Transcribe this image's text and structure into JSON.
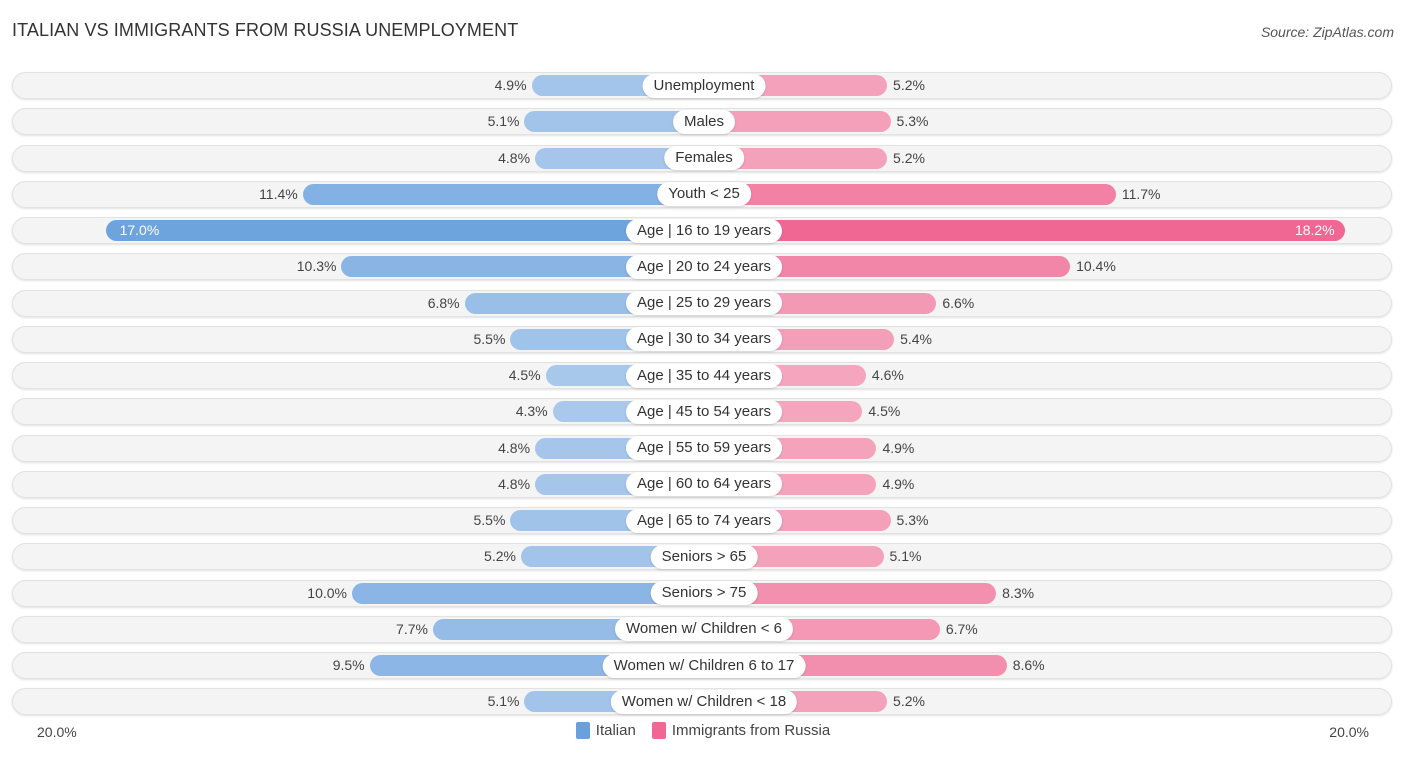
{
  "header": {
    "title": "ITALIAN VS IMMIGRANTS FROM RUSSIA UNEMPLOYMENT",
    "source": "Source: ZipAtlas.com"
  },
  "colors": {
    "italian": "#6aa1dd",
    "russia": "#f06793",
    "italian_light": "#a9c8ec",
    "russia_light": "#f5a8c0"
  },
  "chart_data": {
    "type": "bar",
    "orientation": "horizontal-diverging",
    "title": "ITALIAN VS IMMIGRANTS FROM RUSSIA UNEMPLOYMENT",
    "categories": [
      "Unemployment",
      "Males",
      "Females",
      "Youth < 25",
      "Age | 16 to 19 years",
      "Age | 20 to 24 years",
      "Age | 25 to 29 years",
      "Age | 30 to 34 years",
      "Age | 35 to 44 years",
      "Age | 45 to 54 years",
      "Age | 55 to 59 years",
      "Age | 60 to 64 years",
      "Age | 65 to 74 years",
      "Seniors > 65",
      "Seniors > 75",
      "Women w/ Children < 6",
      "Women w/ Children 6 to 17",
      "Women w/ Children < 18"
    ],
    "series": [
      {
        "name": "Italian",
        "side": "left",
        "values": [
          4.9,
          5.1,
          4.8,
          11.4,
          17.0,
          10.3,
          6.8,
          5.5,
          4.5,
          4.3,
          4.8,
          4.8,
          5.5,
          5.2,
          10.0,
          7.7,
          9.5,
          5.1
        ],
        "labels": [
          "4.9%",
          "5.1%",
          "4.8%",
          "11.4%",
          "17.0%",
          "10.3%",
          "6.8%",
          "5.5%",
          "4.5%",
          "4.3%",
          "4.8%",
          "4.8%",
          "5.5%",
          "5.2%",
          "10.0%",
          "7.7%",
          "9.5%",
          "5.1%"
        ]
      },
      {
        "name": "Immigrants from Russia",
        "side": "right",
        "values": [
          5.2,
          5.3,
          5.2,
          11.7,
          18.2,
          10.4,
          6.6,
          5.4,
          4.6,
          4.5,
          4.9,
          4.9,
          5.3,
          5.1,
          8.3,
          6.7,
          8.6,
          5.2
        ],
        "labels": [
          "5.2%",
          "5.3%",
          "5.2%",
          "11.7%",
          "18.2%",
          "10.4%",
          "6.6%",
          "5.4%",
          "4.6%",
          "4.5%",
          "4.9%",
          "4.9%",
          "5.3%",
          "5.1%",
          "8.3%",
          "6.7%",
          "8.6%",
          "5.2%"
        ]
      }
    ],
    "xlim": [
      -20,
      20
    ],
    "axis_labels": {
      "left": "20.0%",
      "right": "20.0%"
    },
    "unit": "%",
    "legend": {
      "position": "bottom-center",
      "entries": [
        "Italian",
        "Immigrants from Russia"
      ]
    },
    "grid": false
  }
}
